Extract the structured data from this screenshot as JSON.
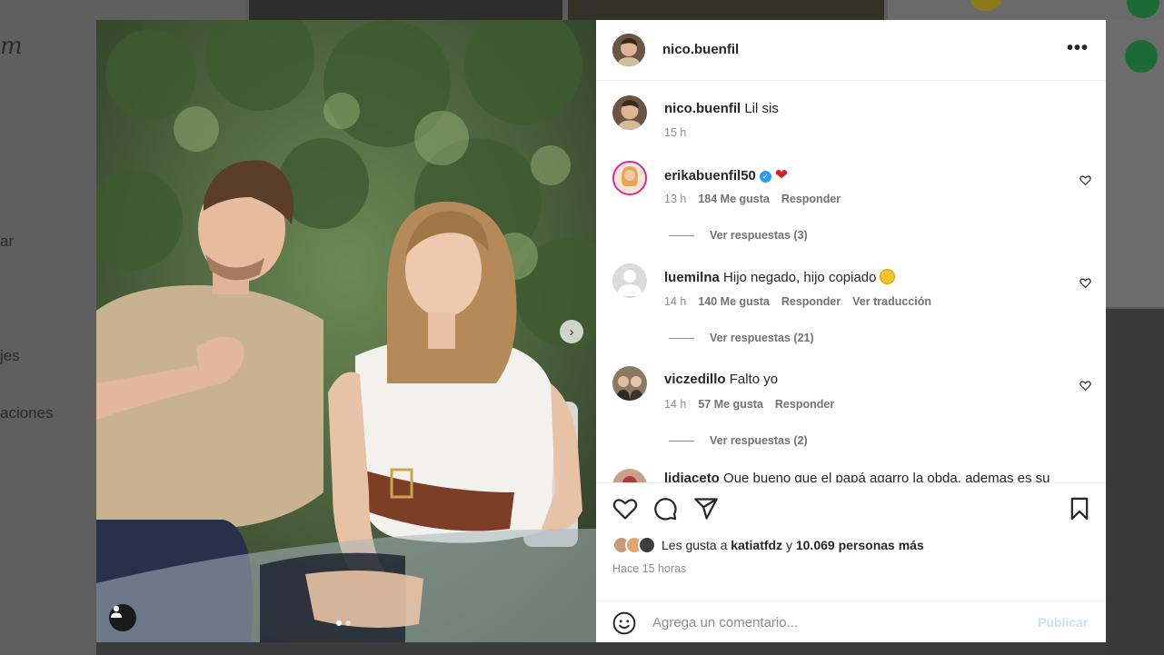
{
  "background": {
    "logo": "m",
    "nav_items": [
      "ar",
      "jes",
      "aciones"
    ]
  },
  "post": {
    "author": "nico.buenfil",
    "caption": "Lil sis",
    "caption_time": "15 h",
    "media": {
      "description": "photo-carousel",
      "current_slide": 1,
      "total_slides": 2
    }
  },
  "comments": [
    {
      "user": "erikabuenfil50",
      "verified": true,
      "text": "",
      "emoji": "heart",
      "time": "13 h",
      "likes": "184 Me gusta",
      "reply": "Responder",
      "translate": "",
      "replies": "Ver respuestas (3)"
    },
    {
      "user": "luemilna",
      "verified": false,
      "text": "Hijo negado, hijo copiado",
      "emoji": "smile",
      "time": "14 h",
      "likes": "140 Me gusta",
      "reply": "Responder",
      "translate": "Ver traducción",
      "replies": "Ver respuestas (21)"
    },
    {
      "user": "viczedillo",
      "verified": false,
      "text": "Falto yo",
      "emoji": "",
      "time": "14 h",
      "likes": "57 Me gusta",
      "reply": "Responder",
      "translate": "",
      "replies": "Ver respuestas (2)"
    },
    {
      "user": "lidiaceto",
      "verified": false,
      "text": "Que bueno que el papá agarro la obda, ademas es su",
      "emoji": "",
      "time": "",
      "likes": "",
      "reply": "",
      "translate": "",
      "replies": ""
    }
  ],
  "likes_summary": {
    "prefix": "Les gusta a",
    "first_user": "katiatfdz",
    "connector": "y",
    "others": "10.069 personas más"
  },
  "posted_ago": "Hace 15 horas",
  "comment_box": {
    "placeholder": "Agrega un comentario...",
    "publish_label": "Publicar"
  },
  "icons": {
    "more": "more-options-icon",
    "like": "heart-icon",
    "comment": "comment-icon",
    "share": "share-icon",
    "save": "bookmark-icon",
    "emoji": "emoji-icon",
    "next": "chevron-right-icon",
    "tag": "user-tag-icon"
  },
  "colors": {
    "primary_text": "#262626",
    "secondary_text": "#8e8e8e",
    "verified": "#2f9bf0",
    "heart": "#e01d25",
    "publish_disabled": "#c7e0fd"
  }
}
